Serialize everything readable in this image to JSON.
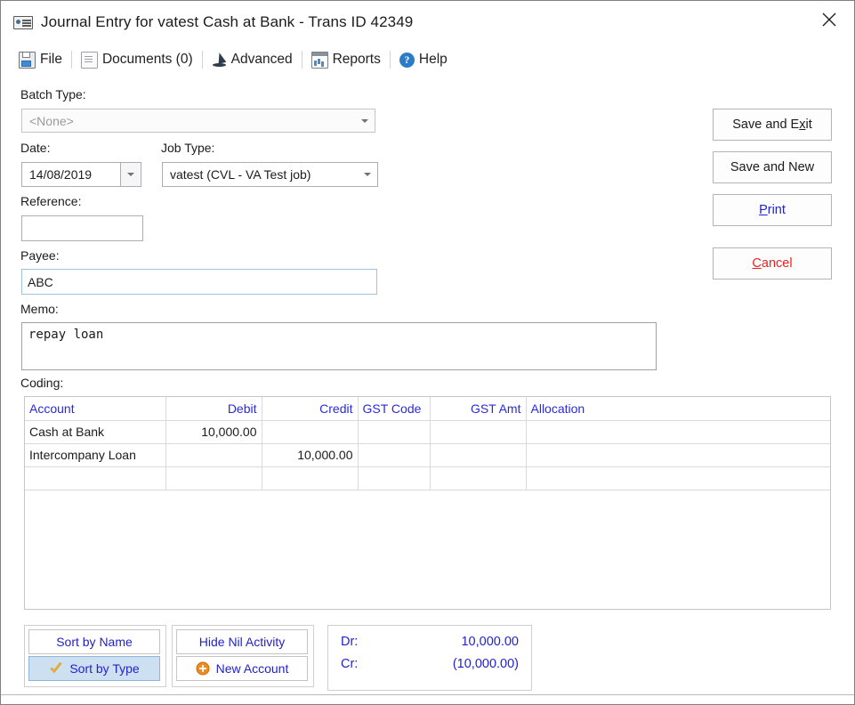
{
  "window": {
    "title": "Journal Entry for vatest Cash at Bank - Trans ID 42349",
    "title_icon": "cheque-icon",
    "close_icon": "close-icon"
  },
  "menubar": {
    "items": [
      {
        "label": "File",
        "icon": "save-icon"
      },
      {
        "label": "Documents (0)",
        "icon": "document-icon"
      },
      {
        "label": "Advanced",
        "icon": "wizard-hat-icon"
      },
      {
        "label": "Reports",
        "icon": "report-icon"
      },
      {
        "label": "Help",
        "icon": "help-icon",
        "glyph": "?"
      }
    ]
  },
  "form": {
    "batch_type": {
      "label": "Batch Type:",
      "value": "<None>",
      "disabled": true
    },
    "date": {
      "label": "Date:",
      "value": "14/08/2019"
    },
    "job_type": {
      "label": "Job Type:",
      "value": "vatest (CVL - VA Test job)"
    },
    "reference": {
      "label": "Reference:",
      "value": ""
    },
    "payee": {
      "label": "Payee:",
      "value": "ABC"
    },
    "memo": {
      "label": "Memo:",
      "value": "repay loan"
    },
    "coding_label": "Coding:"
  },
  "actions": {
    "save_and_exit": {
      "pre": "Save and E",
      "accel": "x",
      "post": "it"
    },
    "save_and_new": "Save and New",
    "print": {
      "accel": "P",
      "post": "rint"
    },
    "cancel": {
      "accel": "C",
      "post": "ancel"
    }
  },
  "grid": {
    "columns": [
      {
        "label": "Account",
        "align": "left"
      },
      {
        "label": "Debit",
        "align": "right"
      },
      {
        "label": "Credit",
        "align": "right"
      },
      {
        "label": "GST Code",
        "align": "left"
      },
      {
        "label": "GST Amt",
        "align": "right"
      },
      {
        "label": "Allocation",
        "align": "left"
      }
    ],
    "rows": [
      {
        "account": "Cash at Bank",
        "debit": "10,000.00",
        "credit": "",
        "gst_code": "",
        "gst_amt": "",
        "allocation": ""
      },
      {
        "account": "Intercompany Loan",
        "debit": "",
        "credit": "10,000.00",
        "gst_code": "",
        "gst_amt": "",
        "allocation": ""
      },
      {
        "account": "",
        "debit": "",
        "credit": "",
        "gst_code": "",
        "gst_amt": "",
        "allocation": ""
      }
    ]
  },
  "footer": {
    "sort_by_name": "Sort by Name",
    "sort_by_type": {
      "label": "Sort by Type",
      "icon": "check-icon",
      "active": true
    },
    "hide_nil_activity": "Hide Nil Activity",
    "new_account": {
      "label": "New Account",
      "icon": "plus-circle-icon"
    },
    "totals": {
      "dr_label": "Dr:",
      "dr_value": "10,000.00",
      "cr_label": "Cr:",
      "cr_value": "(10,000.00)"
    }
  },
  "colors": {
    "link_blue": "#2222cc",
    "header_blue": "#2a2ae0",
    "cancel_red": "#ee2222",
    "accent_orange": "#f08a1d",
    "selected_bg": "#cde0f2"
  }
}
